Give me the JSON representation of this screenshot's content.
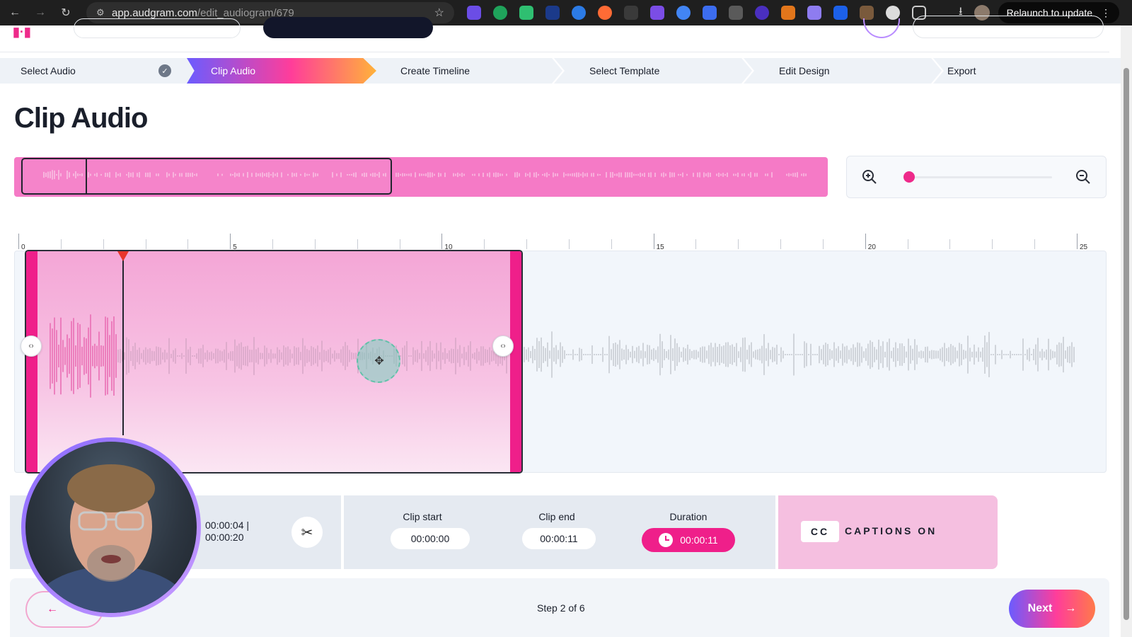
{
  "browser": {
    "url_host": "app.audgram.com",
    "url_path": "/edit_audiogram/679",
    "relaunch_label": "Relaunch to update"
  },
  "steps": [
    {
      "label": "Select Audio",
      "state": "done"
    },
    {
      "label": "Clip Audio",
      "state": "active"
    },
    {
      "label": "Create Timeline",
      "state": "todo"
    },
    {
      "label": "Select Template",
      "state": "todo"
    },
    {
      "label": "Edit Design",
      "state": "todo"
    },
    {
      "label": "Export",
      "state": "todo"
    }
  ],
  "page": {
    "title": "Clip Audio"
  },
  "zoom": {
    "level_fraction": 0.0
  },
  "ruler": {
    "labels": [
      "0",
      "5",
      "10",
      "15",
      "20",
      "25"
    ]
  },
  "clip_controls": {
    "current_time": "00:00:04 |",
    "total_time": "00:00:20",
    "clip_start_label": "Clip start",
    "clip_start_value": "00:00:00",
    "clip_end_label": "Clip end",
    "clip_end_value": "00:00:11",
    "duration_label": "Duration",
    "duration_value": "00:00:11"
  },
  "captions": {
    "cc_label": "CC",
    "status": "CAPTIONS ON"
  },
  "footer": {
    "step_info": "Step 2 of 6",
    "next_label": "Next",
    "back_arrow": "←",
    "next_arrow": "→"
  },
  "colors": {
    "accent": "#ef1f8a",
    "clip_fill": "#f4a6d6",
    "overview_fill": "#f57ac6",
    "playhead_marker": "#e8342b"
  }
}
